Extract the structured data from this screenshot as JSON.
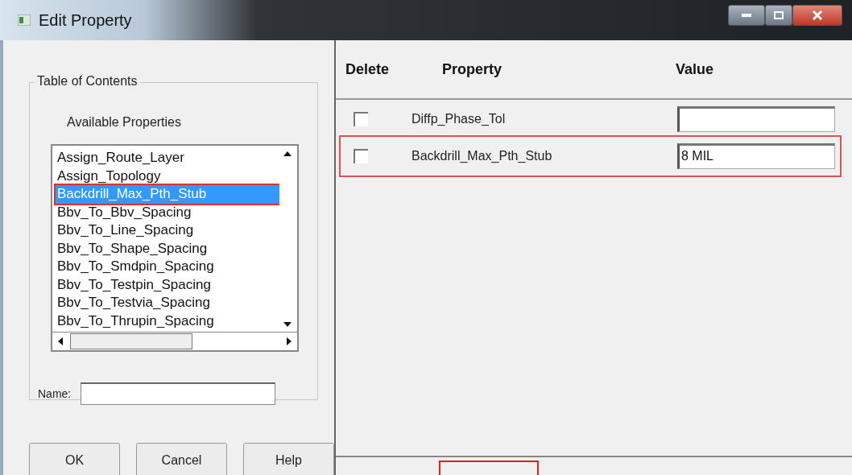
{
  "window": {
    "title": "Edit Property"
  },
  "table_of_contents": {
    "title": "Table of Contents",
    "list_label": "Available Properties",
    "items": [
      {
        "label": "Assign_Route_Layer",
        "selected": false,
        "highlighted": false
      },
      {
        "label": "Assign_Topology",
        "selected": false,
        "highlighted": false
      },
      {
        "label": "Backdrill_Max_Pth_Stub",
        "selected": true,
        "highlighted": true
      },
      {
        "label": "Bbv_To_Bbv_Spacing",
        "selected": false,
        "highlighted": false
      },
      {
        "label": "Bbv_To_Line_Spacing",
        "selected": false,
        "highlighted": false
      },
      {
        "label": "Bbv_To_Shape_Spacing",
        "selected": false,
        "highlighted": false
      },
      {
        "label": "Bbv_To_Smdpin_Spacing",
        "selected": false,
        "highlighted": false
      },
      {
        "label": "Bbv_To_Testpin_Spacing",
        "selected": false,
        "highlighted": false
      },
      {
        "label": "Bbv_To_Testvia_Spacing",
        "selected": false,
        "highlighted": false
      },
      {
        "label": "Bbv_To_Thrupin_Spacing",
        "selected": false,
        "highlighted": false
      }
    ],
    "name_label": "Name:"
  },
  "buttons": [
    "OK",
    "Cancel",
    "Help"
  ],
  "properties": {
    "columns": [
      "Delete",
      "Property",
      "Value"
    ],
    "rows": [
      {
        "checked": false,
        "name": "Diffp_Phase_Tol",
        "highlighted": false
      },
      {
        "checked": false,
        "name": "Backdrill_Max_Pth_Stub",
        "value": "8 MIL",
        "highlighted": true
      }
    ],
    "footer_highlight": true
  }
}
